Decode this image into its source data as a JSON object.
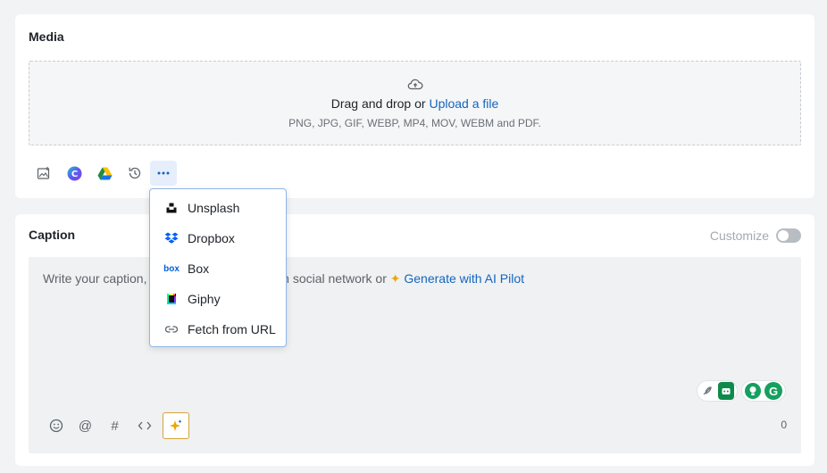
{
  "media": {
    "title": "Media",
    "dropzone": {
      "text": "Drag and drop or",
      "link": "Upload a file",
      "formats": "PNG, JPG, GIF, WEBP, MP4, MOV, WEBM and PDF."
    },
    "tools": [
      {
        "icon": "image-library-icon"
      },
      {
        "icon": "canva-icon"
      },
      {
        "icon": "google-drive-icon"
      },
      {
        "icon": "history-icon"
      },
      {
        "icon": "more-icon"
      }
    ]
  },
  "dropdown": {
    "items": [
      {
        "label": "Unsplash",
        "icon": "unsplash-icon"
      },
      {
        "label": "Dropbox",
        "icon": "dropbox-icon"
      },
      {
        "label": "Box",
        "icon": "box-icon"
      },
      {
        "label": "Giphy",
        "icon": "giphy-icon"
      },
      {
        "label": "Fetch from URL",
        "icon": "link-icon"
      }
    ]
  },
  "caption": {
    "title": "Caption",
    "customize_label": "Customize",
    "placeholder_start": "Write your caption,",
    "placeholder_end": "th social network or",
    "ai_link": "Generate with AI Pilot",
    "char_count": "0",
    "editor_tools": [
      {
        "icon": "emoji-icon",
        "glyph": "☺"
      },
      {
        "icon": "mention-icon",
        "glyph": "@"
      },
      {
        "icon": "hashtag-icon",
        "glyph": "#"
      },
      {
        "icon": "code-icon",
        "glyph": "<>"
      },
      {
        "icon": "ai-sparkle-icon",
        "glyph": "✦"
      }
    ]
  },
  "colors": {
    "link": "#1565c0",
    "accent_border": "#8fb6e8",
    "ai_gold": "#f0a500"
  }
}
